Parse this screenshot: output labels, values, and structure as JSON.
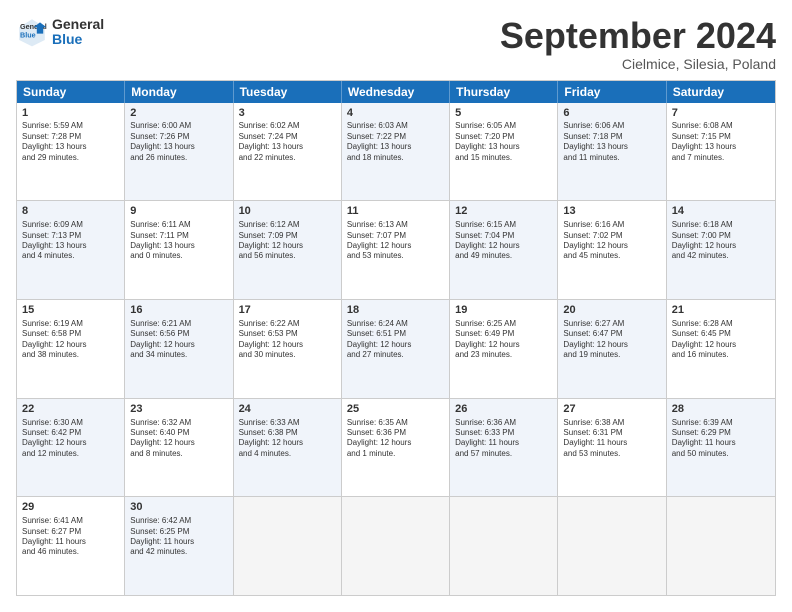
{
  "logo": {
    "line1": "General",
    "line2": "Blue"
  },
  "title": "September 2024",
  "subtitle": "Cielmice, Silesia, Poland",
  "headers": [
    "Sunday",
    "Monday",
    "Tuesday",
    "Wednesday",
    "Thursday",
    "Friday",
    "Saturday"
  ],
  "rows": [
    [
      {
        "day": "",
        "info": "",
        "empty": true
      },
      {
        "day": "2",
        "info": "Sunrise: 6:00 AM\nSunset: 7:26 PM\nDaylight: 13 hours\nand 26 minutes.",
        "alt": true
      },
      {
        "day": "3",
        "info": "Sunrise: 6:02 AM\nSunset: 7:24 PM\nDaylight: 13 hours\nand 22 minutes.",
        "alt": false
      },
      {
        "day": "4",
        "info": "Sunrise: 6:03 AM\nSunset: 7:22 PM\nDaylight: 13 hours\nand 18 minutes.",
        "alt": true
      },
      {
        "day": "5",
        "info": "Sunrise: 6:05 AM\nSunset: 7:20 PM\nDaylight: 13 hours\nand 15 minutes.",
        "alt": false
      },
      {
        "day": "6",
        "info": "Sunrise: 6:06 AM\nSunset: 7:18 PM\nDaylight: 13 hours\nand 11 minutes.",
        "alt": true
      },
      {
        "day": "7",
        "info": "Sunrise: 6:08 AM\nSunset: 7:15 PM\nDaylight: 13 hours\nand 7 minutes.",
        "alt": false
      }
    ],
    [
      {
        "day": "1",
        "info": "Sunrise: 5:59 AM\nSunset: 7:28 PM\nDaylight: 13 hours\nand 29 minutes.",
        "alt": false
      },
      {
        "day": "",
        "info": "",
        "empty": true
      },
      {
        "day": "",
        "info": "",
        "empty": true
      },
      {
        "day": "",
        "info": "",
        "empty": true
      },
      {
        "day": "",
        "info": "",
        "empty": true
      },
      {
        "day": "",
        "info": "",
        "empty": true
      },
      {
        "day": "",
        "info": "",
        "empty": true
      }
    ],
    [
      {
        "day": "8",
        "info": "Sunrise: 6:09 AM\nSunset: 7:13 PM\nDaylight: 13 hours\nand 4 minutes.",
        "alt": true
      },
      {
        "day": "9",
        "info": "Sunrise: 6:11 AM\nSunset: 7:11 PM\nDaylight: 13 hours\nand 0 minutes.",
        "alt": false
      },
      {
        "day": "10",
        "info": "Sunrise: 6:12 AM\nSunset: 7:09 PM\nDaylight: 12 hours\nand 56 minutes.",
        "alt": true
      },
      {
        "day": "11",
        "info": "Sunrise: 6:13 AM\nSunset: 7:07 PM\nDaylight: 12 hours\nand 53 minutes.",
        "alt": false
      },
      {
        "day": "12",
        "info": "Sunrise: 6:15 AM\nSunset: 7:04 PM\nDaylight: 12 hours\nand 49 minutes.",
        "alt": true
      },
      {
        "day": "13",
        "info": "Sunrise: 6:16 AM\nSunset: 7:02 PM\nDaylight: 12 hours\nand 45 minutes.",
        "alt": false
      },
      {
        "day": "14",
        "info": "Sunrise: 6:18 AM\nSunset: 7:00 PM\nDaylight: 12 hours\nand 42 minutes.",
        "alt": true
      }
    ],
    [
      {
        "day": "15",
        "info": "Sunrise: 6:19 AM\nSunset: 6:58 PM\nDaylight: 12 hours\nand 38 minutes.",
        "alt": false
      },
      {
        "day": "16",
        "info": "Sunrise: 6:21 AM\nSunset: 6:56 PM\nDaylight: 12 hours\nand 34 minutes.",
        "alt": true
      },
      {
        "day": "17",
        "info": "Sunrise: 6:22 AM\nSunset: 6:53 PM\nDaylight: 12 hours\nand 30 minutes.",
        "alt": false
      },
      {
        "day": "18",
        "info": "Sunrise: 6:24 AM\nSunset: 6:51 PM\nDaylight: 12 hours\nand 27 minutes.",
        "alt": true
      },
      {
        "day": "19",
        "info": "Sunrise: 6:25 AM\nSunset: 6:49 PM\nDaylight: 12 hours\nand 23 minutes.",
        "alt": false
      },
      {
        "day": "20",
        "info": "Sunrise: 6:27 AM\nSunset: 6:47 PM\nDaylight: 12 hours\nand 19 minutes.",
        "alt": true
      },
      {
        "day": "21",
        "info": "Sunrise: 6:28 AM\nSunset: 6:45 PM\nDaylight: 12 hours\nand 16 minutes.",
        "alt": false
      }
    ],
    [
      {
        "day": "22",
        "info": "Sunrise: 6:30 AM\nSunset: 6:42 PM\nDaylight: 12 hours\nand 12 minutes.",
        "alt": true
      },
      {
        "day": "23",
        "info": "Sunrise: 6:32 AM\nSunset: 6:40 PM\nDaylight: 12 hours\nand 8 minutes.",
        "alt": false
      },
      {
        "day": "24",
        "info": "Sunrise: 6:33 AM\nSunset: 6:38 PM\nDaylight: 12 hours\nand 4 minutes.",
        "alt": true
      },
      {
        "day": "25",
        "info": "Sunrise: 6:35 AM\nSunset: 6:36 PM\nDaylight: 12 hours\nand 1 minute.",
        "alt": false
      },
      {
        "day": "26",
        "info": "Sunrise: 6:36 AM\nSunset: 6:33 PM\nDaylight: 11 hours\nand 57 minutes.",
        "alt": true
      },
      {
        "day": "27",
        "info": "Sunrise: 6:38 AM\nSunset: 6:31 PM\nDaylight: 11 hours\nand 53 minutes.",
        "alt": false
      },
      {
        "day": "28",
        "info": "Sunrise: 6:39 AM\nSunset: 6:29 PM\nDaylight: 11 hours\nand 50 minutes.",
        "alt": true
      }
    ],
    [
      {
        "day": "29",
        "info": "Sunrise: 6:41 AM\nSunset: 6:27 PM\nDaylight: 11 hours\nand 46 minutes.",
        "alt": false
      },
      {
        "day": "30",
        "info": "Sunrise: 6:42 AM\nSunset: 6:25 PM\nDaylight: 11 hours\nand 42 minutes.",
        "alt": true
      },
      {
        "day": "",
        "info": "",
        "empty": true
      },
      {
        "day": "",
        "info": "",
        "empty": true
      },
      {
        "day": "",
        "info": "",
        "empty": true
      },
      {
        "day": "",
        "info": "",
        "empty": true
      },
      {
        "day": "",
        "info": "",
        "empty": true
      }
    ]
  ]
}
